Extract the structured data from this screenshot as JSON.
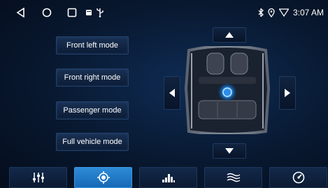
{
  "status_bar": {
    "nav_icons": [
      "back-icon",
      "home-icon",
      "recents-icon"
    ],
    "notification_icons": [
      "notification-square-icon",
      "usb-icon"
    ],
    "system_icons": [
      "bluetooth-icon",
      "location-icon",
      "wifi-icon"
    ],
    "time": "3:07 AM"
  },
  "modes": [
    {
      "label": "Front left mode"
    },
    {
      "label": "Front right mode"
    },
    {
      "label": "Passenger mode"
    },
    {
      "label": "Full vehicle mode"
    }
  ],
  "balance_controls": [
    "arrow-up",
    "arrow-down",
    "arrow-left",
    "arrow-right"
  ],
  "bottom_tabs": [
    {
      "icon": "equalizer-sliders-icon",
      "active": false
    },
    {
      "icon": "sound-field-target-icon",
      "active": true
    },
    {
      "icon": "bass-levels-icon",
      "active": false
    },
    {
      "icon": "waves-icon",
      "active": false
    },
    {
      "icon": "speedometer-icon",
      "active": false
    }
  ],
  "colors": {
    "background": "#08182f",
    "active_tab": "#2e8bd6",
    "button_border": "#24426a"
  }
}
